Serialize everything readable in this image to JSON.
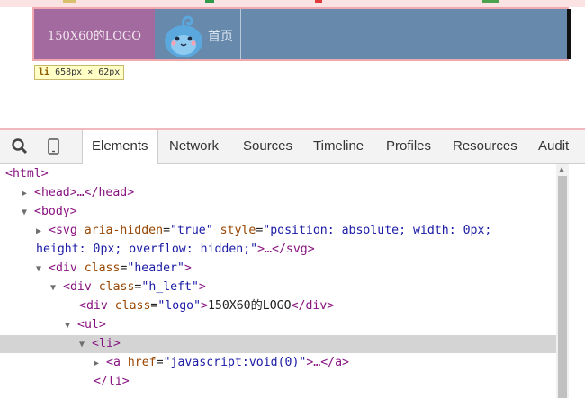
{
  "preview": {
    "logo_text": "150X60的LOGO",
    "nav_label": "首页",
    "tooltip_tag": "li",
    "tooltip_dims": "658px × 62px",
    "colors": {
      "header_bg": "#4e7194",
      "logo_bg": "#a26a9e",
      "highlight_border": "#f0a9ae"
    }
  },
  "devtools": {
    "toolbar_icons": [
      "search-icon",
      "device-mode-icon"
    ],
    "tabs": [
      {
        "label": "Elements",
        "active": true
      },
      {
        "label": "Network",
        "active": false
      },
      {
        "label": "Sources",
        "active": false
      },
      {
        "label": "Timeline",
        "active": false
      },
      {
        "label": "Profiles",
        "active": false
      },
      {
        "label": "Resources",
        "active": false
      },
      {
        "label": "Audit",
        "active": false
      }
    ],
    "dom": {
      "html_open": "<html>",
      "head": "<head>…</head>",
      "body_open": "<body>",
      "svg_tag_open": "<svg",
      "svg_attr1_name": "aria-hidden",
      "svg_attr1_val": "\"true\"",
      "svg_attr2_name": "style",
      "svg_attr2_val_a": "\"position: absolute; width: 0px;",
      "svg_attr2_val_b": "height: 0px; overflow: hidden;\"",
      "svg_close": ">…</svg>",
      "div_header_name": "<div",
      "div_header_attr": "class",
      "div_header_val": "\"header\"",
      "div_hleft_val": "\"h_left\"",
      "div_logo_val": "\"logo\"",
      "logo_content": "150X60的LOGO",
      "div_close": "</div>",
      "ul_open": "<ul>",
      "li_open": "<li>",
      "a_tag": "<a",
      "a_attr": "href",
      "a_val": "\"javascript:void(0)\"",
      "a_close": ">…</a>",
      "li_close": "</li>",
      "gt": ">",
      "eq": "="
    }
  }
}
